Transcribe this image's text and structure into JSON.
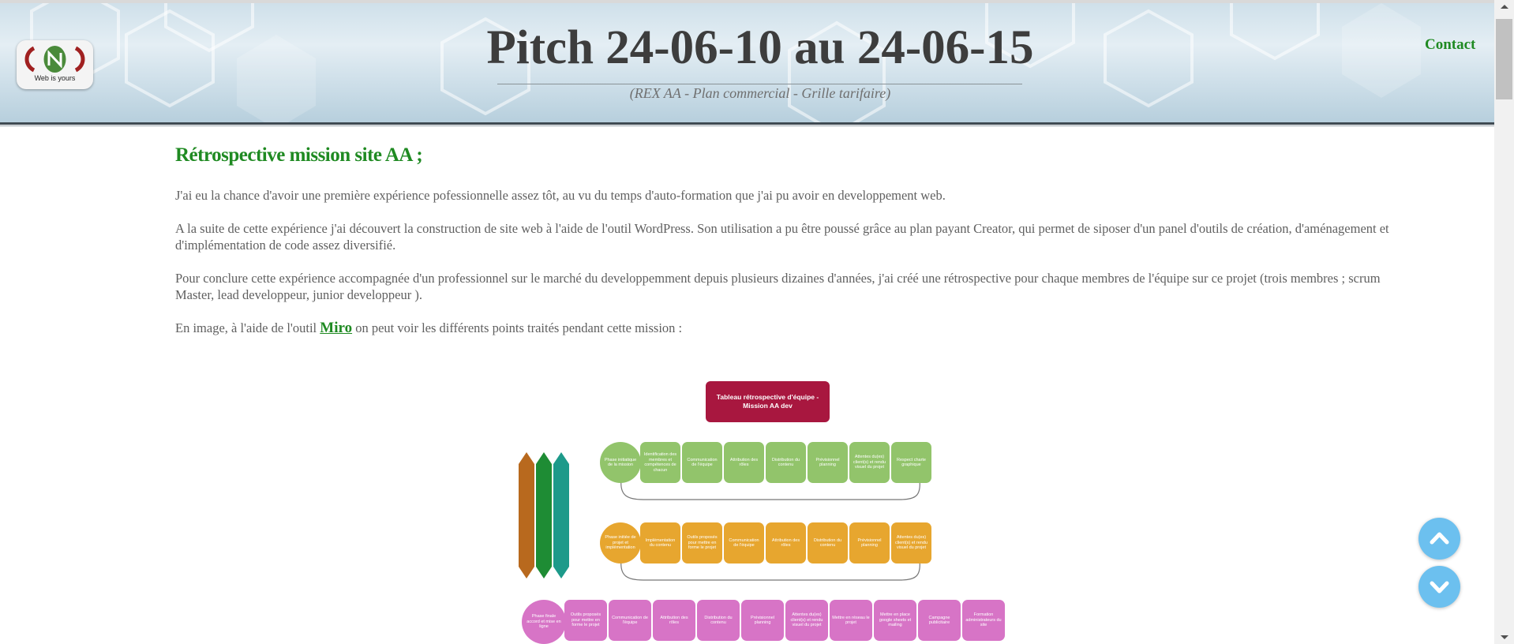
{
  "header": {
    "logo_text": "Web is yours",
    "title": "Pitch 24-06-10 au 24-06-15",
    "subtitle": "(REX AA - Plan commercial - Grille tarifaire)",
    "contact_label": "Contact"
  },
  "content": {
    "section_title": "Rétrospective mission site AA ;",
    "paragraphs": [
      "J'ai eu la chance d'avoir une première expérience pofessionnelle assez tôt, au vu du temps d'auto-formation que j'ai pu avoir en developpement web.",
      "A la suite de cette expérience j'ai découvert la construction de site web à l'aide de l'outil WordPress. Son utilisation a pu être poussé grâce au plan payant Creator, qui permet de siposer d'un panel d'outils de création, d'aménagement et d'implémentation de code assez diversifié.",
      "Pour conclure cette expérience accompagnée d'un professionnel sur le marché du developpemment depuis plusieurs dizaines d'années, j'ai créé une rétrospective pour chaque membres de l'équipe sur ce projet (trois membres ; scrum Master, lead developpeur, junior developpeur )."
    ],
    "miro_sentence_before": "En image, à l'aide de l'outil ",
    "miro_link": "Miro",
    "miro_sentence_after": " on peut voir les différents points traités pendant cette mission :"
  },
  "diagram": {
    "title": "Tableau rétrospective d'équipe - Mission AA dev",
    "row1": {
      "phase": "Phase initiatique de la mission",
      "items": [
        "Identification des membres et compétences de chacun",
        "Communication de l'équipe",
        "Attribution des rôles",
        "Distribution du contenu",
        "Prévisionnel planning",
        "Attentes du(es) client(s) et rendu visuel du projet",
        "Respect charte graphique"
      ]
    },
    "row2": {
      "phase": "Phase initiée de projet et implémentation",
      "items": [
        "Implémentation du contenu",
        "Outils proposés pour mettre en forme le projet",
        "Communication de l'équipe",
        "Attribution des rôles",
        "Distribution du contenu",
        "Prévisionnel planning",
        "Attentes du(es) client(s) et rendu visuel du projet"
      ]
    },
    "row3": {
      "phase": "Phase finale accord et mise en ligne",
      "items": [
        "Outils proposés pour mettre en forme le projet",
        "Communication de l'équipe",
        "Attribution des rôles",
        "Distribution du contenu",
        "Prévisionnel planning",
        "Attentes du(es) client(s) et rendu visuel du projet",
        "Mettre en réseau le projet",
        "Mettre en place google sheets et mailing",
        "Campagne publicitaire",
        "Formation administrateurs du site"
      ]
    },
    "arrow_colors": [
      "#b8691e",
      "#1e8c34",
      "#1d9a8a"
    ]
  },
  "colors": {
    "accent_green": "#1f8a22",
    "title_box": "#a8173f",
    "fab_blue": "#6cc0ef"
  }
}
